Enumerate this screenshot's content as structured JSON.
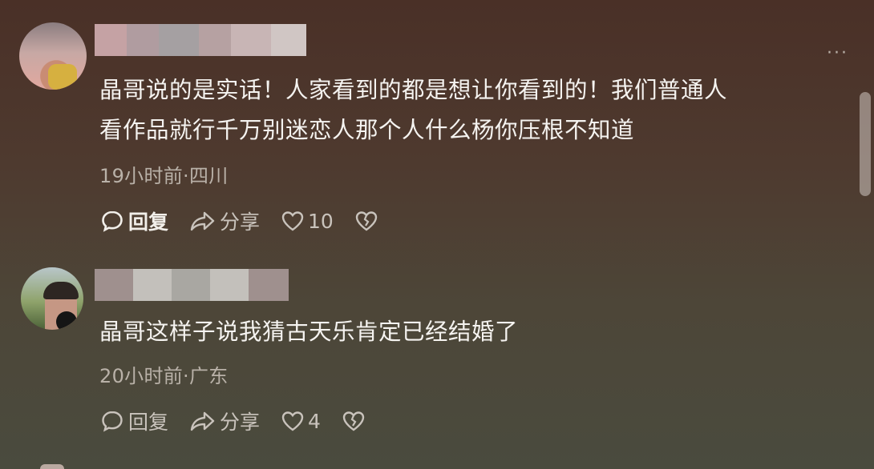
{
  "comments": [
    {
      "text_line1": "晶哥说的是实话！人家看到的都是想让你看到的！我们普通人",
      "text_line2": "看作品就行千万别迷恋人那个人什么杨你压根不知道",
      "meta": "19小时前·四川",
      "reply_label": "回复",
      "share_label": "分享",
      "likes": "10"
    },
    {
      "text_line1": "晶哥这样子说我猜古天乐肯定已经结婚了",
      "text_line2": "",
      "meta": "20小时前·广东",
      "reply_label": "回复",
      "share_label": "分享",
      "likes": "4"
    }
  ],
  "more_menu": "···",
  "icons": {
    "reply": "comment-bubble-icon",
    "share": "share-arrow-icon",
    "like": "heart-icon",
    "dislike": "broken-heart-icon",
    "more": "ellipsis-icon"
  },
  "colors": {
    "text": "#f5f3f0",
    "meta": "#b9b1a8",
    "action": "#c9c3bc"
  }
}
